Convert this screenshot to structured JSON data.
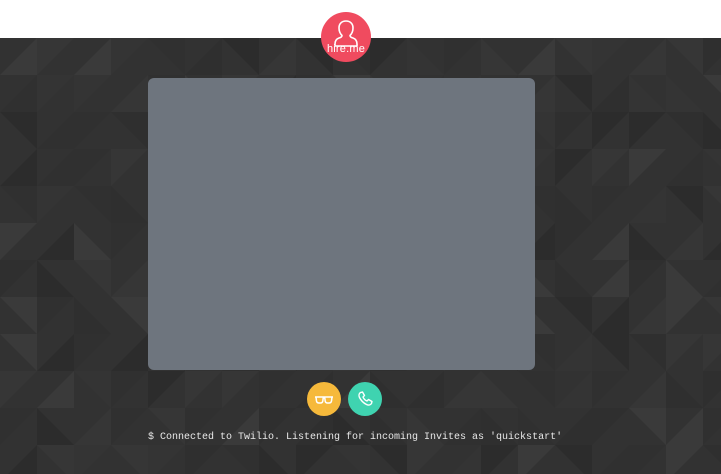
{
  "header": {
    "logo_text": "hire.me",
    "logo_icon": "person-silhouette-icon",
    "logo_color": "#f04b5f"
  },
  "stage": {
    "background_color": "#323232",
    "video_placeholder_color": "#6e757e"
  },
  "controls": {
    "preview": {
      "icon": "glasses-icon",
      "color": "#f6b93b"
    },
    "call": {
      "icon": "phone-icon",
      "color": "#3fd3b0"
    }
  },
  "log": {
    "message": "$ Connected to Twilio. Listening for incoming Invites as 'quickstart'"
  }
}
